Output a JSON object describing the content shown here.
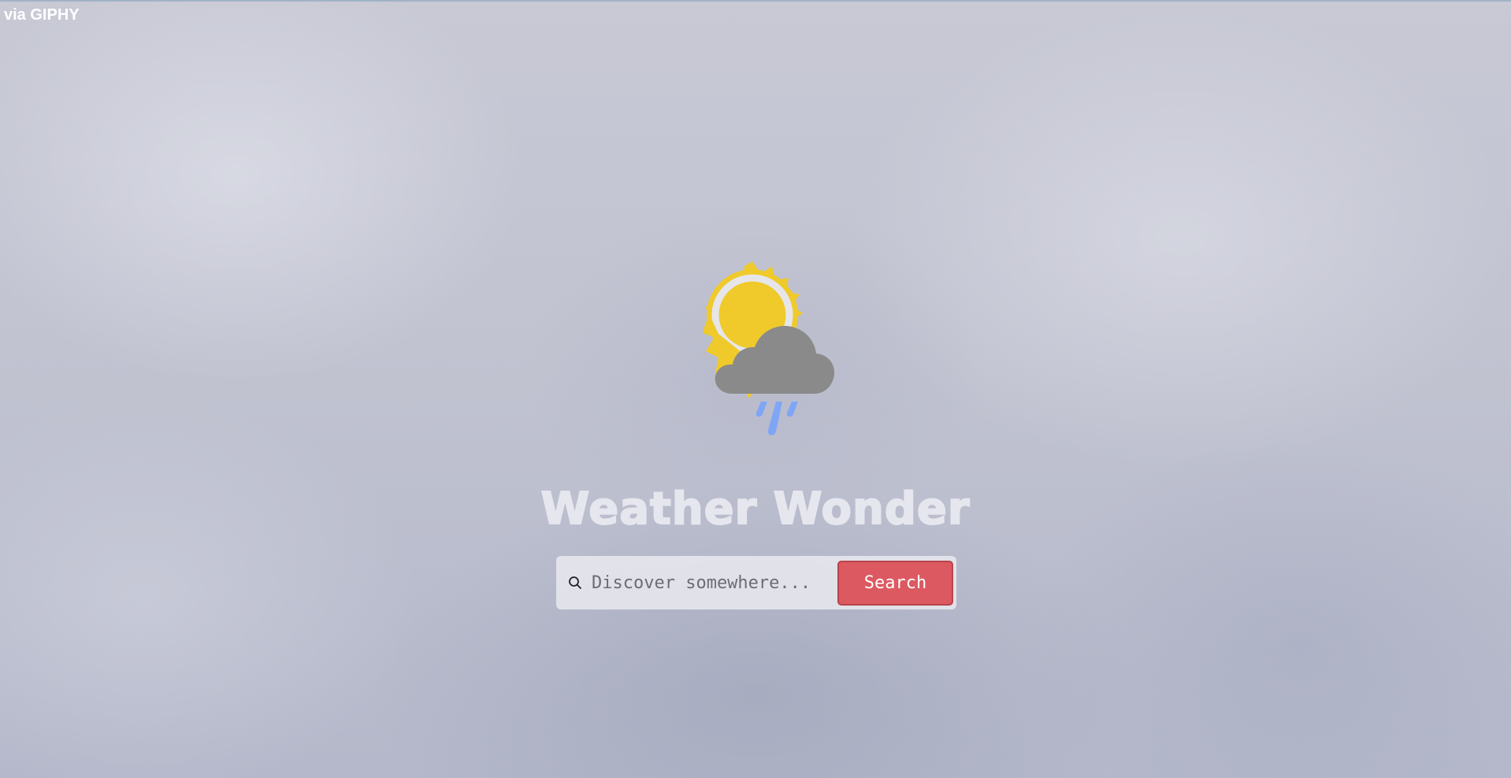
{
  "credit": {
    "label": "via GIPHY"
  },
  "app": {
    "title": "Weather Wonder",
    "logo_icon": "sun-cloud-rain-icon"
  },
  "search": {
    "icon": "search-icon",
    "placeholder": "Discover somewhere...",
    "button_label": "Search"
  },
  "colors": {
    "sun": "#efca2a",
    "cloud": "#8a8a8a",
    "rain": "#7fa6f5",
    "button": "#dc5961",
    "title": "#e6e6ee"
  }
}
